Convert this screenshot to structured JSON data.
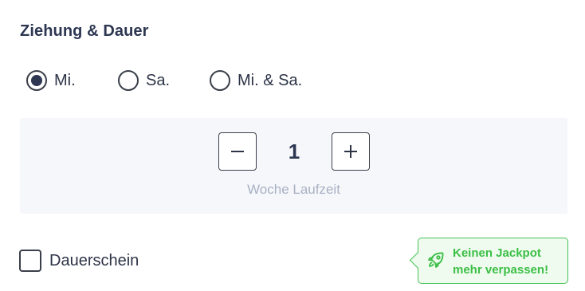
{
  "section": {
    "title": "Ziehung & Dauer"
  },
  "draw_options": {
    "selected": "Mi.",
    "items": [
      {
        "label": "Mi."
      },
      {
        "label": "Sa."
      },
      {
        "label": "Mi. & Sa."
      }
    ]
  },
  "duration": {
    "value": "1",
    "label": "Woche Laufzeit",
    "decrement_icon": "minus-icon",
    "increment_icon": "plus-icon"
  },
  "permanent": {
    "label": "Dauerschein",
    "checked": false
  },
  "promo": {
    "line1": "Keinen Jackpot",
    "line2": "mehr verpassen!",
    "icon": "rocket-icon",
    "color": "#3cbf46"
  }
}
